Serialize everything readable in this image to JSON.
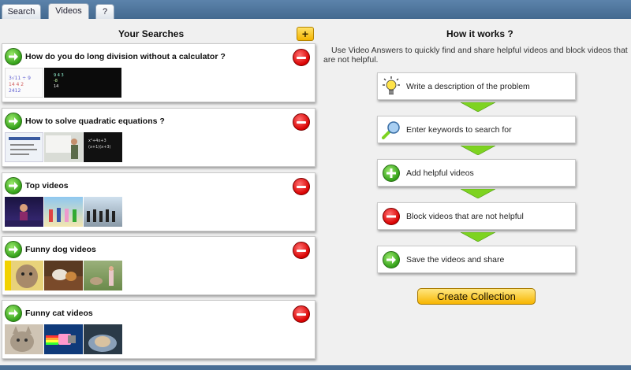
{
  "tabs": [
    {
      "label": "Search",
      "active": false
    },
    {
      "label": "Videos",
      "active": true
    },
    {
      "label": "?",
      "active": false
    }
  ],
  "left": {
    "heading": "Your Searches",
    "add_label": "+",
    "searches": [
      {
        "title": "How do you do long division without a calculator ?",
        "thumbs": [
          "math-whiteboard",
          "math-blackboard"
        ]
      },
      {
        "title": "How to solve quadratic equations ?",
        "thumbs": [
          "lecture-slide",
          "teacher-whiteboard",
          "math-blackboard"
        ]
      },
      {
        "title": "Top videos",
        "thumbs": [
          "concert-stage",
          "group-beach",
          "dance-crowd"
        ]
      },
      {
        "title": "Funny dog videos",
        "thumbs": [
          "dog-closeup",
          "dog-couch",
          "dog-backyard"
        ]
      },
      {
        "title": "Funny cat videos",
        "thumbs": [
          "cat-closeup",
          "nyan-cat",
          "cat-in-bowl"
        ]
      }
    ]
  },
  "right": {
    "heading": "How it works ?",
    "intro": "Use Video Answers to quickly find and share helpful videos and block videos that are not helpful.",
    "steps": [
      {
        "label": "Write a description of the problem",
        "icon": "lightbulb-icon"
      },
      {
        "label": "Enter keywords to search for",
        "icon": "magnifier-icon"
      },
      {
        "label": "Add helpful videos",
        "icon": "plus-circle-icon"
      },
      {
        "label": "Block videos that are not helpful",
        "icon": "minus-circle-icon"
      },
      {
        "label": "Save the videos and share",
        "icon": "arrow-circle-icon"
      }
    ],
    "create_label": "Create Collection"
  },
  "colors": {
    "frame": "#4a6e94",
    "surface": "#f0f0f0",
    "go_green": "#33a019",
    "remove_red": "#d90000",
    "button_yellow": "#f7b500",
    "step_arrow": "#7ed321"
  }
}
